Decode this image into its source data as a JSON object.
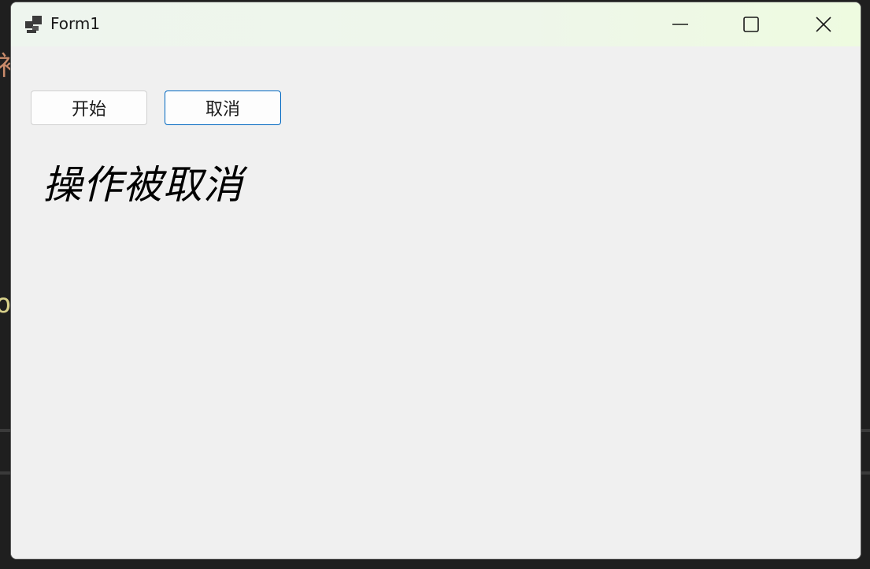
{
  "window": {
    "title": "Form1",
    "icon": "app-window-icon",
    "controls": {
      "minimize_icon": "minimize-icon",
      "maximize_icon": "maximize-icon",
      "close_icon": "close-icon"
    }
  },
  "form": {
    "start_button_label": "开始",
    "cancel_button_label": "取消",
    "status_text": "操作被取消"
  },
  "colors": {
    "focus_border": "#0067c0",
    "client_background": "#f0f0f0",
    "titlebar_tint": "#eefbe0"
  }
}
